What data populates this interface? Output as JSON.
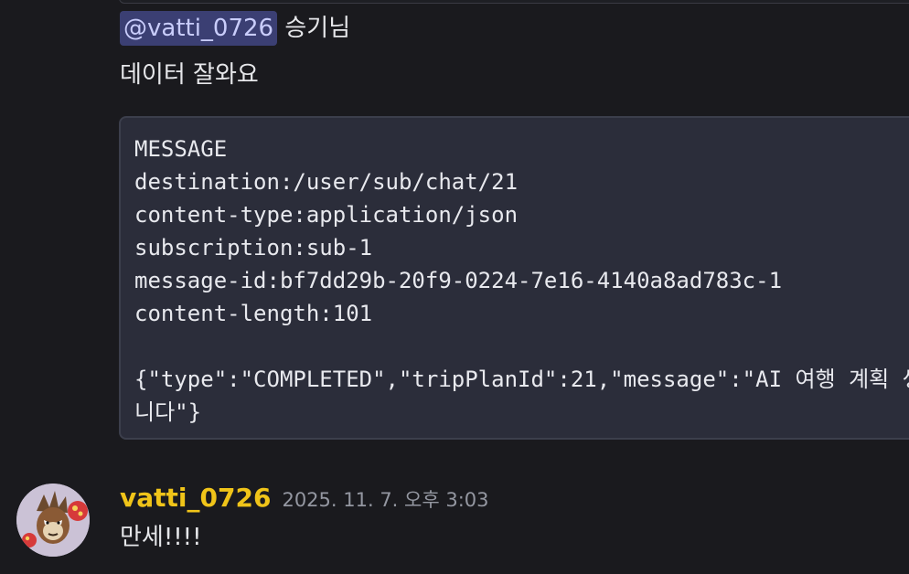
{
  "message_prev": {
    "mention": "@vatti_0726",
    "mention_suffix": " 승기님",
    "text": "데이터 잘와요",
    "code_lines": [
      "MESSAGE",
      "destination:/user/sub/chat/21",
      "content-type:application/json",
      "subscription:sub-1",
      "message-id:bf7dd29b-20f9-0224-7e16-4140a8ad783c-1",
      "content-length:101",
      "",
      "{\"type\":\"COMPLETED\",\"tripPlanId\":21,\"message\":\"AI 여행 계획 생성이 완료되었습",
      "니다\"}"
    ]
  },
  "message_current": {
    "username": "vatti_0726",
    "timestamp": "2025. 11. 7. 오후 3:03",
    "text": "만세!!!!"
  },
  "colors": {
    "background": "#1a1a1e",
    "mention_bg": "#3b3f73",
    "mention_text": "#c9cdfb",
    "username": "#f0c419",
    "code_bg": "#2b2d3a"
  },
  "icons": {
    "avatar": "user-avatar-image"
  }
}
